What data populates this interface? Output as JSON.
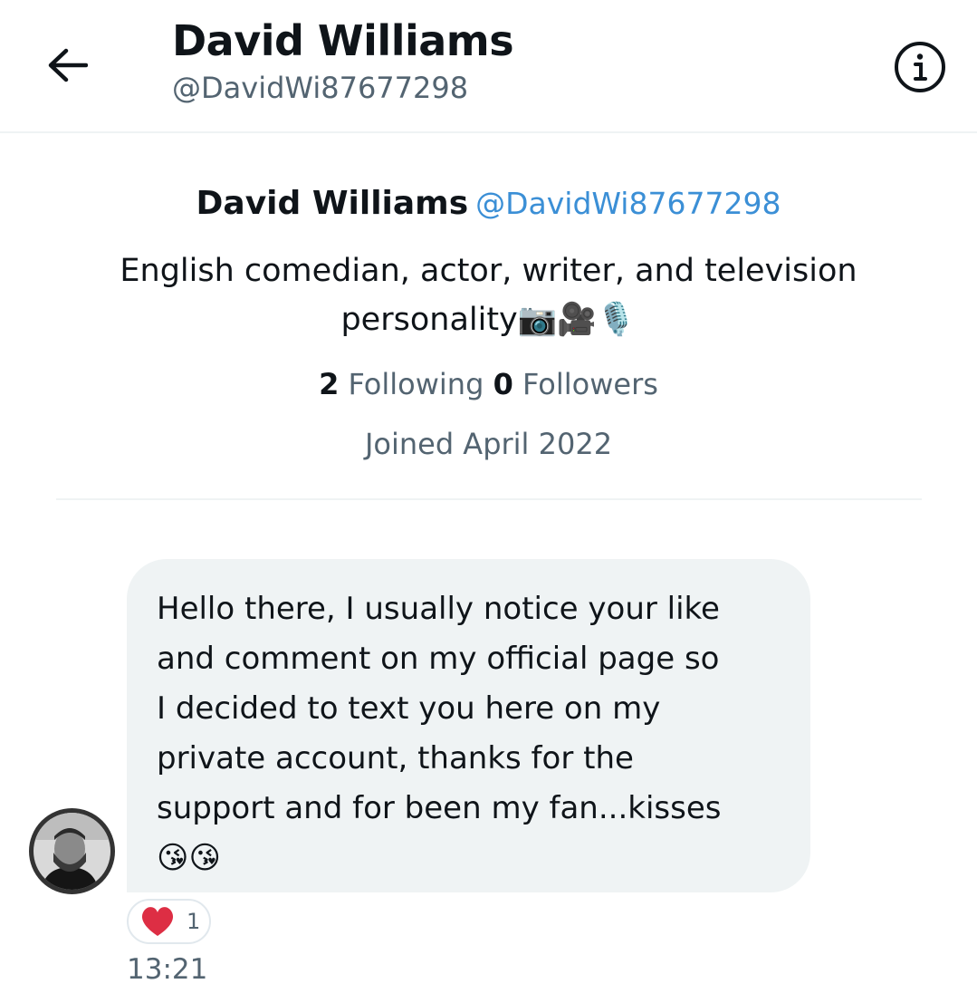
{
  "header": {
    "title": "David Williams",
    "handle": "@DavidWi87677298"
  },
  "icons": {
    "back": "back-arrow-icon",
    "info": "info-icon",
    "reaction": "heart-icon"
  },
  "profile": {
    "name": "David Williams",
    "handle": "@DavidWi87677298",
    "bio_line1": "English comedian, actor, writer, and television",
    "bio_line2": "personality📷🎥🎙️",
    "following_count": "2",
    "following_label": "Following",
    "followers_count": "0",
    "followers_label": "Followers",
    "joined": "Joined April 2022"
  },
  "message": {
    "text": "Hello there, I usually notice your like\nand comment on my official page so\nI decided to text you here on my\nprivate account, thanks for the\nsupport and for been my fan...kisses\n😘😘",
    "reaction_emoji": "❤️",
    "reaction_count": "1",
    "time": "13:21"
  },
  "colors": {
    "accent": "#1d9bf0",
    "bubble": "#eff3f4",
    "heart": "#e0245e",
    "muted": "#536471"
  }
}
